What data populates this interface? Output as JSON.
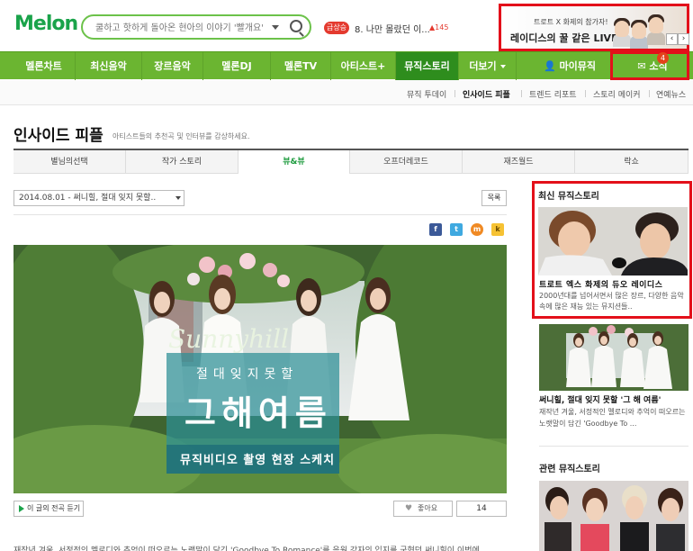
{
  "header": {
    "logo": "Melon",
    "search_placeholder": "쿨하고 핫하게 돌아온 현아의 이야기 '빨개요'",
    "hot_badge": "급상승",
    "hot_text": "8. 나만 몰랐던 이...",
    "hot_rank": "▲145",
    "ad": {
      "line1": "트로트 X 화제의 참가자!",
      "line2": "레이디스의 꿀 같은 LIVE"
    }
  },
  "nav": {
    "items": [
      "멜론차트",
      "최신음악",
      "장르음악",
      "멜론DJ",
      "멜론TV",
      "아티스트+",
      "뮤직스토리",
      "더보기"
    ],
    "active": "뮤직스토리",
    "my_music": "마이뮤직",
    "notice": "소식",
    "notice_count": "4"
  },
  "subnav": {
    "items": [
      "뮤직 투데이",
      "인사이드 피플",
      "트렌드 리포트",
      "스토리 메이커",
      "연예뉴스"
    ],
    "active": "인사이드 피플"
  },
  "page": {
    "title": "인사이드 피플",
    "description": "아티스트들의 추천곡 및 인터뷰를 감상하세요."
  },
  "tabs": {
    "items": [
      "별님의선택",
      "작가 스토리",
      "뷰&뷰",
      "오프더레코드",
      "재즈월드",
      "락쇼"
    ],
    "active": "뷰&뷰"
  },
  "controls": {
    "select_value": "2014.08.01 - 써니힐, 절대 잊지 못할..",
    "list_button": "목록"
  },
  "share": {
    "icons": [
      "facebook-icon",
      "twitter-icon",
      "me2day-icon",
      "kakao-icon"
    ],
    "labels": [
      "f",
      "t",
      "m",
      "k"
    ],
    "colors": [
      "#3b5998",
      "#3fa9e0",
      "#f08a24",
      "#f6c233"
    ]
  },
  "hero": {
    "script": "Sunnyhill",
    "line1": "절대잊지못할",
    "line2": "그해여름",
    "line3": "뮤직비디오 촬영 현장 스케치"
  },
  "article": {
    "listen_button": "이 글의 전곡 듣기",
    "like_label": "좋아요",
    "like_count": "14",
    "body": "재작년 겨울, 서정적인 멜로디와 추억이 떠오르는 노랫말이 담긴 'Goodbye To Romance'를 음원 강자의 입지를 굳혔던 써니힐이 이번에"
  },
  "sidebar": {
    "latest_header": "최신 뮤직스토리",
    "story1_title": "트로트 엑스 화제의 듀오 레이디스",
    "story1_desc": "2000년대를 넘어서면서 많은 장르, 다양한 음악 속에 많은 재능 있는 뮤지션들..",
    "story2_title": "써니힐, 절대 잊지 못할 '그 해 여름'",
    "story2_desc": "재작년 겨울, 서정적인 멜로디와 추억이 떠오르는 노랫말이 담긴 'Goodbye To ...",
    "related_header": "관련 뮤직스토리"
  },
  "colors": {
    "brand_green": "#6bb531",
    "active_nav": "#2e8d1d",
    "highlight_red": "#e3101a",
    "tab_active_text": "#1b9a3c"
  }
}
